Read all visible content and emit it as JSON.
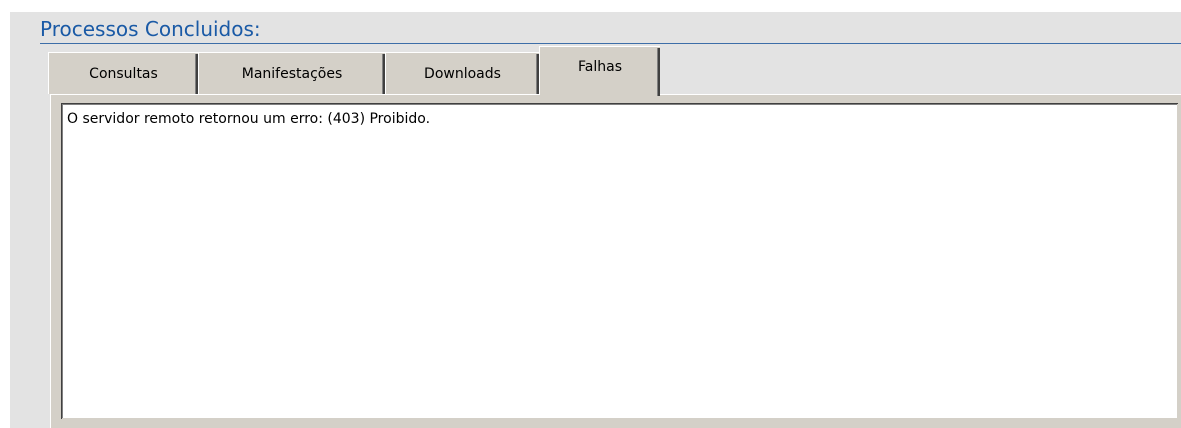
{
  "section": {
    "title": "Processos Concluidos:"
  },
  "tabs": [
    {
      "label": "Consultas",
      "active": false
    },
    {
      "label": "Manifestações",
      "active": false
    },
    {
      "label": "Downloads",
      "active": false
    },
    {
      "label": "Falhas",
      "active": true
    }
  ],
  "failures": {
    "text": "O servidor remoto retornou um erro: (403) Proibido."
  },
  "colors": {
    "title": "#1a5aa6",
    "panel_background": "#e3e3e3",
    "tab_face": "#d4d0c8",
    "textbox_background": "#ffffff"
  }
}
